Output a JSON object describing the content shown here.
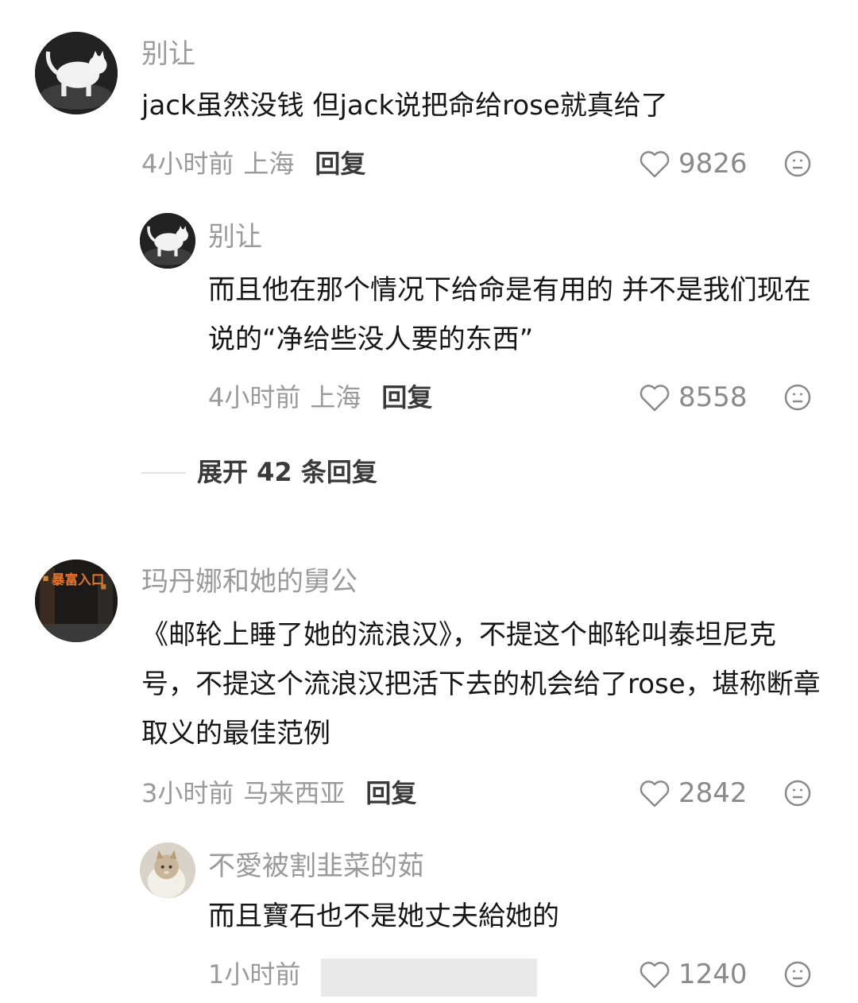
{
  "comments": [
    {
      "username": "别让",
      "text": "jack虽然没钱 但jack说把命给rose就真给了",
      "time": "4小时前",
      "location": "上海",
      "reply_label": "回复",
      "likes": "9826",
      "avatar_icon": "white-cat-avatar",
      "replies": [
        {
          "username": "别让",
          "text": "而且他在那个情况下给命是有用的 并不是我们现在说的“净给些没人要的东西”",
          "time": "4小时前",
          "location": "上海",
          "reply_label": "回复",
          "likes": "8558",
          "avatar_icon": "white-cat-avatar"
        }
      ],
      "expand_label": "展开 42 条回复"
    },
    {
      "username": "玛丹娜和她的舅公",
      "text": "《邮轮上睡了她的流浪汉》，不提这个邮轮叫泰坦尼克号，不提这个流浪汉把活下去的机会给了rose，堪称断章取义的最佳范例",
      "time": "3小时前",
      "location": "马来西亚",
      "reply_label": "回复",
      "likes": "2842",
      "avatar_icon": "poster-avatar",
      "avatar_text": "暴富入口",
      "replies": [
        {
          "username": "不愛被割韭菜的茹",
          "text": "而且寶石也不是她丈夫給她的",
          "time": "1小时前",
          "likes": "1240",
          "avatar_icon": "cat-photo-avatar"
        }
      ]
    }
  ],
  "icons": {
    "like": "heart-outline-icon",
    "more": "emoji-face-icon"
  },
  "colors": {
    "username": "#9a9a9a",
    "text": "#161616",
    "meta": "#9a9a9a",
    "reply": "#3a3a3a"
  }
}
